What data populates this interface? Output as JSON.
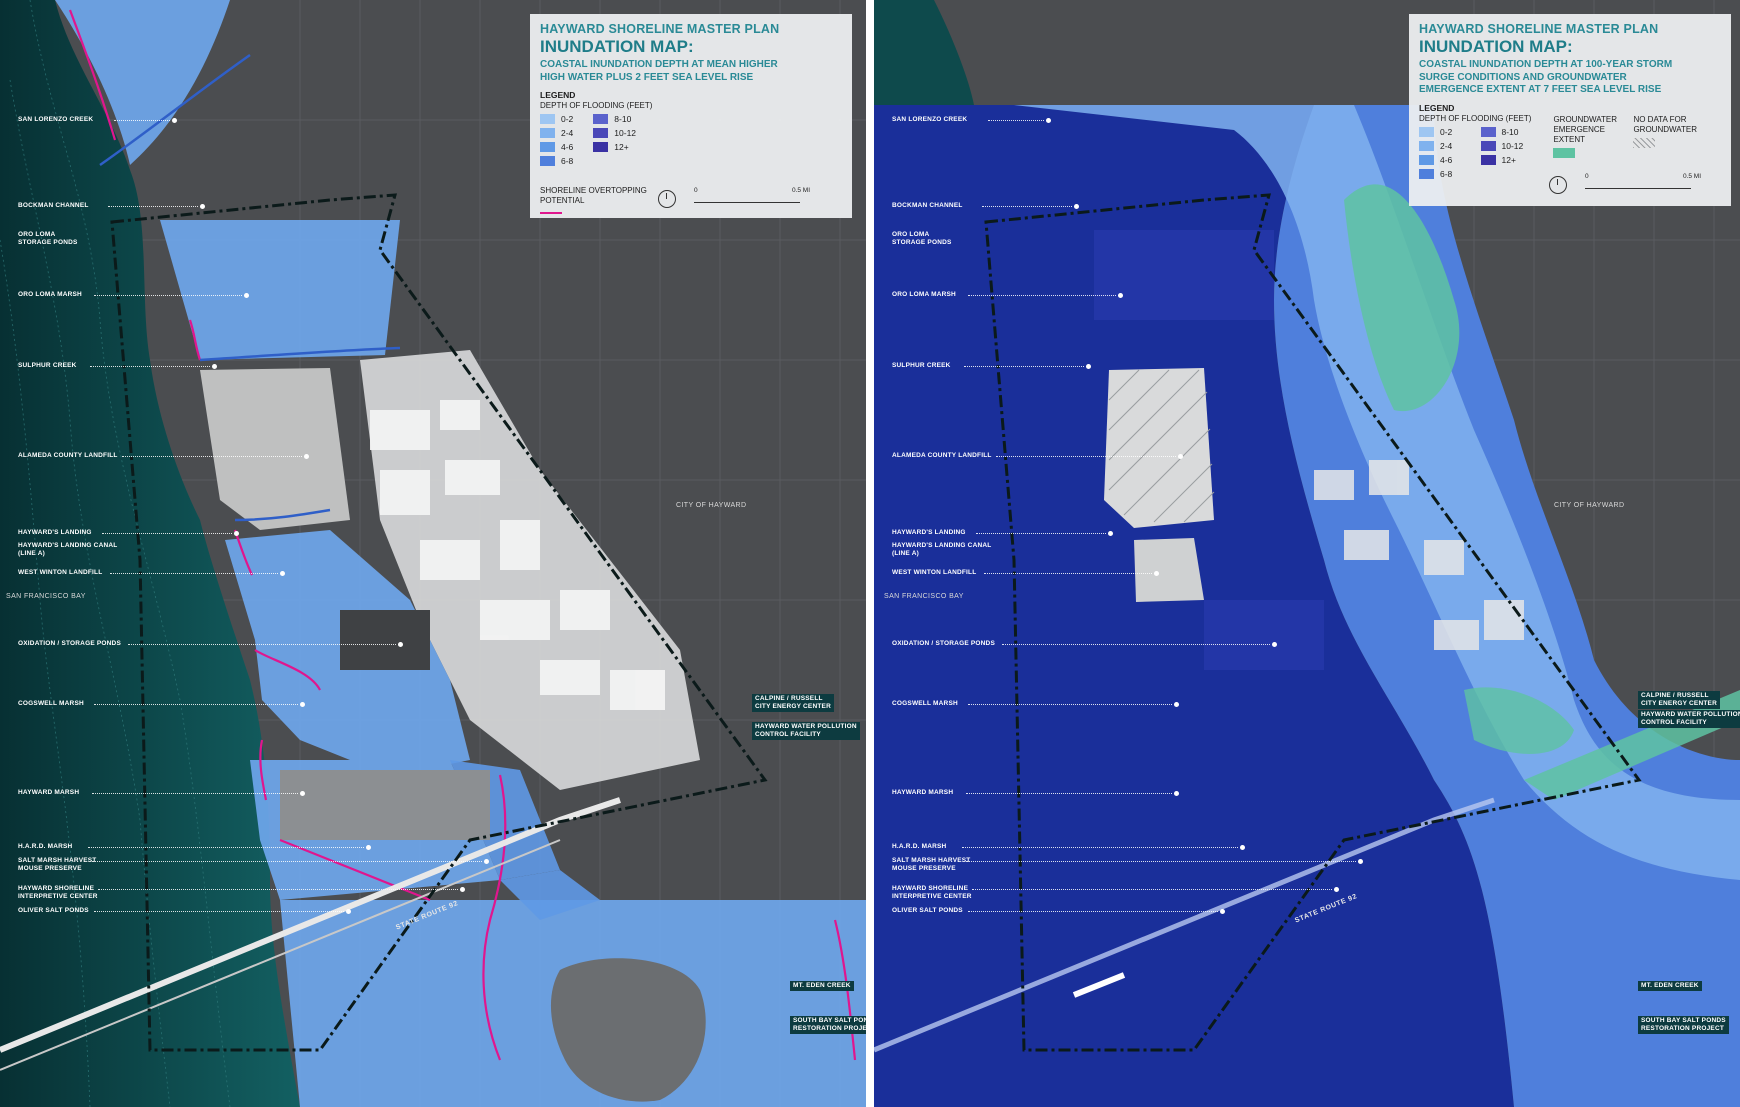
{
  "left": {
    "legend": {
      "kicker": "HAYWARD SHORELINE MASTER PLAN",
      "title": "INUNDATION MAP:",
      "subtitle_line1": "COASTAL INUNDATION DEPTH AT MEAN HIGHER",
      "subtitle_line2": "HIGH WATER PLUS 2 FEET SEA LEVEL RISE",
      "legend_heading": "LEGEND",
      "depth_heading": "DEPTH OF FLOODING (FEET)",
      "classes": [
        {
          "label": "0-2",
          "color": "#9ec6f2"
        },
        {
          "label": "8-10",
          "color": "#5a62cc"
        },
        {
          "label": "2-4",
          "color": "#80b2ee"
        },
        {
          "label": "10-12",
          "color": "#4a48b8"
        },
        {
          "label": "4-6",
          "color": "#5f99e6"
        },
        {
          "label": "12+",
          "color": "#3a32a4"
        },
        {
          "label": "6-8",
          "color": "#4f7fdc"
        }
      ],
      "overtopping_line1": "SHORELINE OVERTOPPING",
      "overtopping_line2": "POTENTIAL",
      "overtopping_color": "#e0168e",
      "north_letter": "N",
      "scale_start": "0",
      "scale_end": "0.5 MI"
    },
    "labels": [
      {
        "text": "SAN LORENZO CREEK"
      },
      {
        "text": "BOCKMAN CHANNEL"
      },
      {
        "text": "ORO LOMA"
      },
      {
        "text": "STORAGE PONDS"
      },
      {
        "text": "ORO LOMA MARSH"
      },
      {
        "text": "SULPHUR CREEK"
      },
      {
        "text": "ALAMEDA COUNTY LANDFILL"
      },
      {
        "text": "HAYWARD'S LANDING"
      },
      {
        "text": "HAYWARD'S LANDING CANAL"
      },
      {
        "text": "(LINE A)"
      },
      {
        "text": "WEST WINTON LANDFILL"
      },
      {
        "text": "OXIDATION / STORAGE PONDS"
      },
      {
        "text": "COGSWELL MARSH"
      },
      {
        "text": "HAYWARD MARSH"
      },
      {
        "text": "H.A.R.D. MARSH"
      },
      {
        "text": "SALT MARSH HARVEST"
      },
      {
        "text": "MOUSE PRESERVE"
      },
      {
        "text": "HAYWARD SHORELINE"
      },
      {
        "text": "INTERPRETIVE CENTER"
      },
      {
        "text": "OLIVER SALT PONDS"
      }
    ],
    "right_labels": [
      {
        "text": "CALPINE / RUSSELL"
      },
      {
        "text": "CITY ENERGY CENTER"
      },
      {
        "text": "HAYWARD WATER POLLUTION"
      },
      {
        "text": "CONTROL FACILITY"
      },
      {
        "text": "MT. EDEN CREEK"
      },
      {
        "text": "SOUTH BAY SALT PONDS"
      },
      {
        "text": "RESTORATION PROJECT"
      }
    ],
    "bay_label": "SAN FRANCISCO BAY",
    "city_label": "CITY OF HAYWARD",
    "route_label": "STATE ROUTE 92"
  },
  "right": {
    "legend": {
      "kicker": "HAYWARD SHORELINE MASTER PLAN",
      "title": "INUNDATION MAP:",
      "subtitle_line1": "COASTAL INUNDATION DEPTH AT 100-YEAR STORM",
      "subtitle_line2": "SURGE CONDITIONS AND GROUNDWATER",
      "subtitle_line3": "EMERGENCE EXTENT AT 7 FEET SEA LEVEL RISE",
      "legend_heading": "LEGEND",
      "depth_heading": "DEPTH OF FLOODING (FEET)",
      "classes": [
        {
          "label": "0-2",
          "color": "#9ec6f2"
        },
        {
          "label": "8-10",
          "color": "#5a62cc"
        },
        {
          "label": "2-4",
          "color": "#80b2ee"
        },
        {
          "label": "10-12",
          "color": "#4a48b8"
        },
        {
          "label": "4-6",
          "color": "#5f99e6"
        },
        {
          "label": "12+",
          "color": "#3a32a4"
        },
        {
          "label": "6-8",
          "color": "#4f7fdc"
        }
      ],
      "groundwater_line1": "GROUNDWATER",
      "groundwater_line2": "EMERGENCE",
      "groundwater_line3": "EXTENT",
      "groundwater_color": "#5ec3a2",
      "nodata_line1": "NO DATA FOR",
      "nodata_line2": "GROUNDWATER",
      "north_letter": "N",
      "scale_start": "0",
      "scale_end": "0.5 MI"
    },
    "bay_label": "SAN FRANCISCO BAY",
    "city_label": "CITY OF HAYWARD",
    "route_label": "STATE ROUTE 92"
  },
  "colors": {
    "land": "#4b4d50",
    "bay": "#0e4a4c",
    "bay_deep": "#093436",
    "deep_flood": "#1a2f9a",
    "boundary": "#0b1a1a"
  }
}
